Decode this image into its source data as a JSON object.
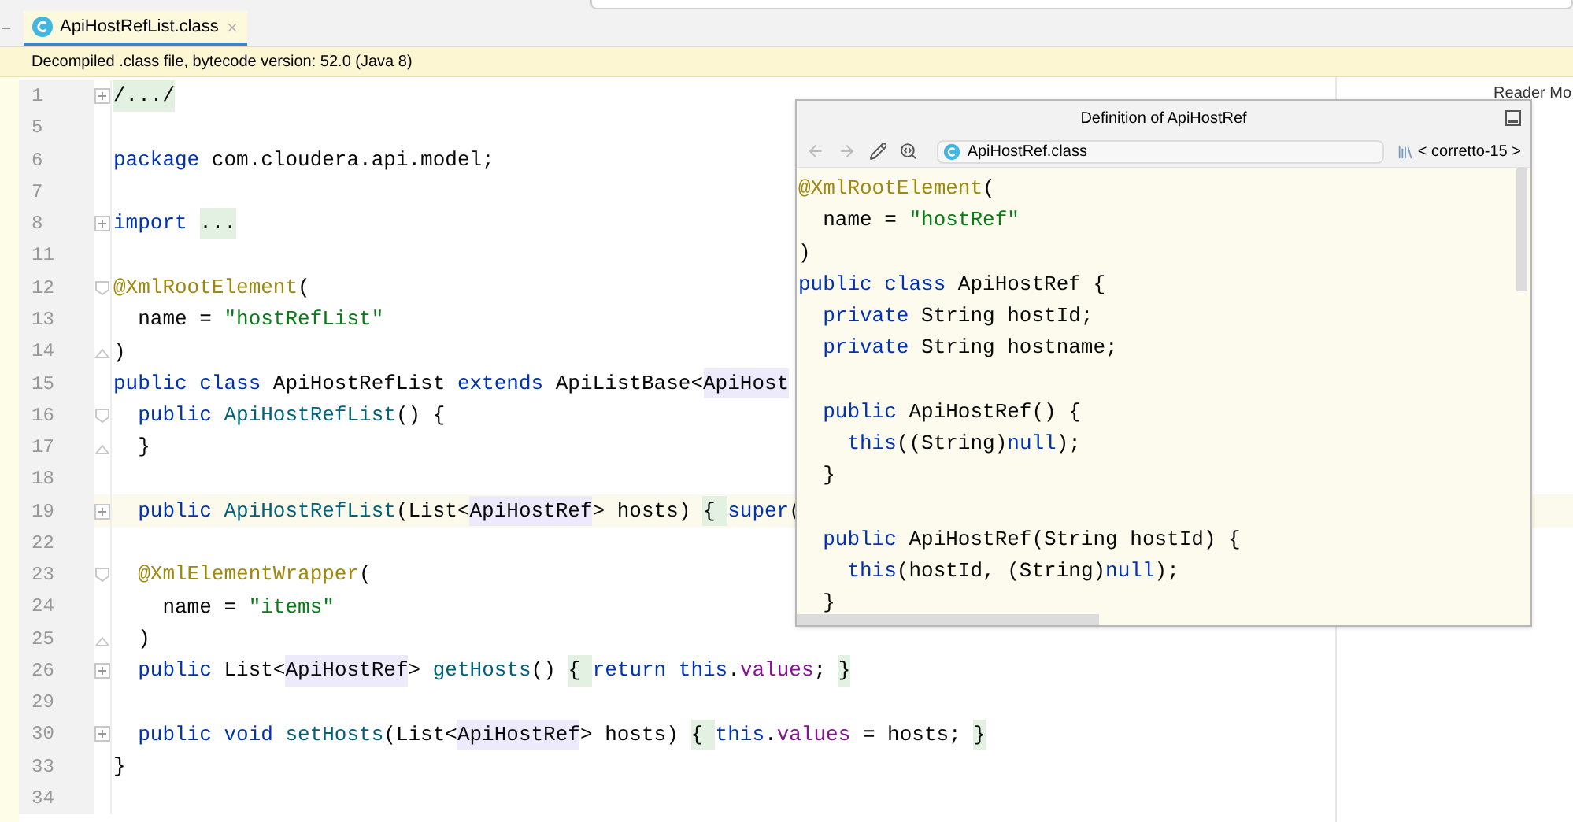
{
  "tab": {
    "label": "ApiHostRefList.class",
    "selected": true
  },
  "notice": "Decompiled .class file, bytecode version: 52.0 (Java 8)",
  "reader_mode": "Reader Mo",
  "editor_lines": [
    {
      "number": "1",
      "kind": "collapsed",
      "current": false,
      "tokens": [
        {
          "kind": "fold",
          "text": "/.../"
        }
      ]
    },
    {
      "number": "5",
      "kind": "plain",
      "current": false
    },
    {
      "number": "6",
      "kind": "plain",
      "current": false,
      "tokens": [
        {
          "kind": "kw",
          "text": "package "
        },
        {
          "kind": "plain",
          "text": "com.cloudera.api.model;"
        }
      ]
    },
    {
      "number": "7",
      "kind": "plain",
      "current": false
    },
    {
      "number": "8",
      "kind": "collapsed",
      "current": false,
      "tokens": [
        {
          "kind": "kw",
          "text": "import "
        },
        {
          "kind": "fold",
          "text": "..."
        }
      ]
    },
    {
      "number": "11",
      "kind": "plain",
      "current": false
    },
    {
      "number": "12",
      "kind": "fold-start",
      "current": false,
      "tokens": [
        {
          "kind": "ann",
          "text": "@XmlRootElement"
        },
        {
          "kind": "plain",
          "text": "("
        }
      ]
    },
    {
      "number": "13",
      "kind": "plain",
      "current": false,
      "tokens": [
        {
          "kind": "plain",
          "text": "  name = "
        },
        {
          "kind": "str",
          "text": "\"hostRefList\""
        }
      ]
    },
    {
      "number": "14",
      "kind": "fold-end",
      "current": false,
      "tokens": [
        {
          "kind": "plain",
          "text": ")"
        }
      ]
    },
    {
      "number": "15",
      "kind": "plain",
      "current": false,
      "tokens": [
        {
          "kind": "kw",
          "text": "public class "
        },
        {
          "kind": "plain",
          "text": "ApiHostRefList "
        },
        {
          "kind": "kw",
          "text": "extends "
        },
        {
          "kind": "plain",
          "text": "ApiListBase<"
        },
        {
          "kind": "type",
          "text": "ApiHost"
        }
      ]
    },
    {
      "number": "16",
      "kind": "fold-start",
      "current": false,
      "tokens": [
        {
          "kind": "kw",
          "text": "  public "
        },
        {
          "kind": "fn",
          "text": "ApiHostRefList"
        },
        {
          "kind": "plain",
          "text": "() {"
        }
      ]
    },
    {
      "number": "17",
      "kind": "fold-end",
      "current": false,
      "tokens": [
        {
          "kind": "plain",
          "text": "  }"
        }
      ]
    },
    {
      "number": "18",
      "kind": "plain",
      "current": false
    },
    {
      "number": "19",
      "kind": "collapsed",
      "current": true,
      "tokens": [
        {
          "kind": "kw",
          "text": "  public "
        },
        {
          "kind": "fn",
          "text": "ApiHostRefList"
        },
        {
          "kind": "plain",
          "text": "(List<"
        },
        {
          "kind": "type",
          "text": "ApiHostRef"
        },
        {
          "kind": "plain",
          "text": "> hosts) "
        },
        {
          "kind": "fold",
          "text": "{ "
        },
        {
          "kind": "kw",
          "text": "super"
        },
        {
          "kind": "plain",
          "text": "("
        }
      ]
    },
    {
      "number": "22",
      "kind": "plain",
      "current": false
    },
    {
      "number": "23",
      "kind": "fold-start",
      "current": false,
      "tokens": [
        {
          "kind": "ann",
          "text": "  @XmlElementWrapper"
        },
        {
          "kind": "plain",
          "text": "("
        }
      ]
    },
    {
      "number": "24",
      "kind": "plain",
      "current": false,
      "tokens": [
        {
          "kind": "plain",
          "text": "    name = "
        },
        {
          "kind": "str",
          "text": "\"items\""
        }
      ]
    },
    {
      "number": "25",
      "kind": "fold-end",
      "current": false,
      "tokens": [
        {
          "kind": "plain",
          "text": "  )"
        }
      ]
    },
    {
      "number": "26",
      "kind": "collapsed",
      "current": false,
      "tokens": [
        {
          "kind": "kw",
          "text": "  public "
        },
        {
          "kind": "plain",
          "text": "List<"
        },
        {
          "kind": "type",
          "text": "ApiHostRef"
        },
        {
          "kind": "plain",
          "text": "> "
        },
        {
          "kind": "fn",
          "text": "getHosts"
        },
        {
          "kind": "plain",
          "text": "() "
        },
        {
          "kind": "fold",
          "text": "{ "
        },
        {
          "kind": "kw",
          "text": "return this"
        },
        {
          "kind": "plain",
          "text": "."
        },
        {
          "kind": "field",
          "text": "values"
        },
        {
          "kind": "plain",
          "text": "; "
        },
        {
          "kind": "fold",
          "text": "}"
        }
      ]
    },
    {
      "number": "29",
      "kind": "plain",
      "current": false
    },
    {
      "number": "30",
      "kind": "collapsed",
      "current": false,
      "tokens": [
        {
          "kind": "kw",
          "text": "  public void "
        },
        {
          "kind": "fn",
          "text": "setHosts"
        },
        {
          "kind": "plain",
          "text": "(List<"
        },
        {
          "kind": "type",
          "text": "ApiHostRef"
        },
        {
          "kind": "plain",
          "text": "> hosts) "
        },
        {
          "kind": "fold",
          "text": "{ "
        },
        {
          "kind": "kw",
          "text": "this"
        },
        {
          "kind": "plain",
          "text": "."
        },
        {
          "kind": "field",
          "text": "values"
        },
        {
          "kind": "plain",
          "text": " = hosts; "
        },
        {
          "kind": "fold",
          "text": "}"
        }
      ]
    },
    {
      "number": "33",
      "kind": "plain",
      "current": false,
      "tokens": [
        {
          "kind": "plain",
          "text": "}"
        }
      ]
    },
    {
      "number": "34",
      "kind": "plain",
      "current": false
    }
  ],
  "popup": {
    "title": "Definition of ApiHostRef",
    "file": "ApiHostRef.class",
    "jdk": "< corretto-15 >",
    "lines": [
      {
        "tokens": [
          {
            "kind": "ann",
            "text": "@XmlRootElement"
          },
          {
            "kind": "plain",
            "text": "("
          }
        ]
      },
      {
        "tokens": [
          {
            "kind": "plain",
            "text": "  name = "
          },
          {
            "kind": "str",
            "text": "\"hostRef\""
          }
        ]
      },
      {
        "tokens": [
          {
            "kind": "plain",
            "text": ")"
          }
        ]
      },
      {
        "tokens": [
          {
            "kind": "kw",
            "text": "public class "
          },
          {
            "kind": "plain",
            "text": "ApiHostRef {"
          }
        ]
      },
      {
        "tokens": [
          {
            "kind": "kw",
            "text": "  private "
          },
          {
            "kind": "plain",
            "text": "String hostId;"
          }
        ]
      },
      {
        "tokens": [
          {
            "kind": "kw",
            "text": "  private "
          },
          {
            "kind": "plain",
            "text": "String hostname;"
          }
        ]
      },
      {
        "kind": "blank"
      },
      {
        "tokens": [
          {
            "kind": "kw",
            "text": "  public "
          },
          {
            "kind": "plain",
            "text": "ApiHostRef() {"
          }
        ]
      },
      {
        "tokens": [
          {
            "kind": "kw",
            "text": "    this"
          },
          {
            "kind": "plain",
            "text": "((String)"
          },
          {
            "kind": "kw",
            "text": "null"
          },
          {
            "kind": "plain",
            "text": ");"
          }
        ]
      },
      {
        "tokens": [
          {
            "kind": "plain",
            "text": "  }"
          }
        ]
      },
      {
        "kind": "blank"
      },
      {
        "tokens": [
          {
            "kind": "kw",
            "text": "  public "
          },
          {
            "kind": "plain",
            "text": "ApiHostRef(String hostId) {"
          }
        ]
      },
      {
        "tokens": [
          {
            "kind": "kw",
            "text": "    this"
          },
          {
            "kind": "plain",
            "text": "(hostId, (String)"
          },
          {
            "kind": "kw",
            "text": "null"
          },
          {
            "kind": "plain",
            "text": ");"
          }
        ]
      },
      {
        "tokens": [
          {
            "kind": "plain",
            "text": "  }"
          }
        ]
      }
    ]
  }
}
